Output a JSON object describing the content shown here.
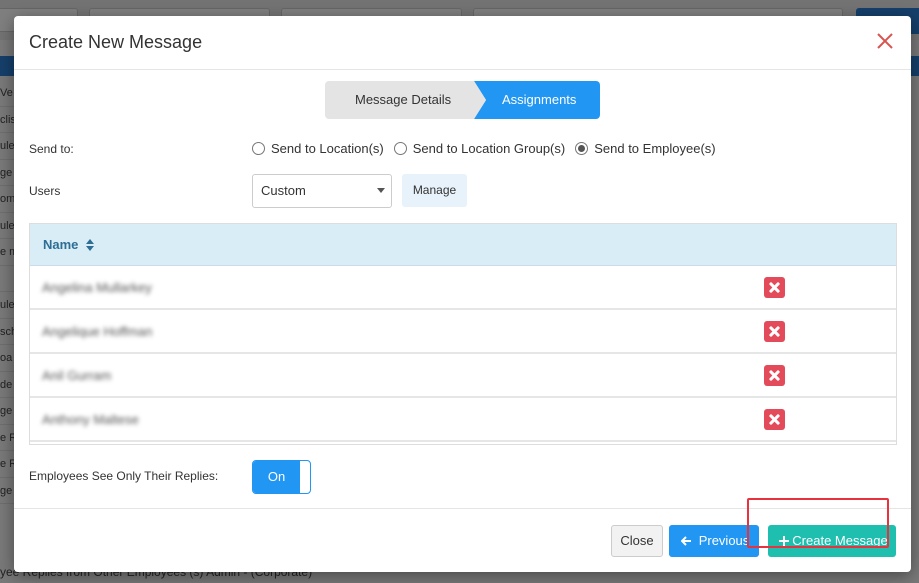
{
  "background": {
    "row_fragments": [
      "Ve",
      "clis",
      "ule",
      "ge",
      "om",
      "ule",
      "e m",
      "",
      "ule",
      "sch",
      "oa",
      "de",
      "ge",
      "e R",
      "e R",
      "ge"
    ],
    "bottom_text": "yee Replies from Other Employees (s)          Admin - (Corporate)"
  },
  "modal": {
    "title": "Create New Message",
    "close_icon": "close-x-icon",
    "steps": [
      {
        "label": "Message Details",
        "active": false
      },
      {
        "label": "Assignments",
        "active": true
      }
    ],
    "send_to": {
      "label": "Send to:",
      "options": [
        {
          "label": "Send to Location(s)",
          "checked": false
        },
        {
          "label": "Send to Location Group(s)",
          "checked": false
        },
        {
          "label": "Send to Employee(s)",
          "checked": true
        }
      ]
    },
    "users": {
      "label": "Users",
      "selected": "Custom",
      "manage_label": "Manage"
    },
    "table": {
      "header": "Name",
      "rows": [
        {
          "name": "Angelina Mullarkey"
        },
        {
          "name": "Angelique Hoffman"
        },
        {
          "name": "Anil Gurram"
        },
        {
          "name": "Anthony Maltese"
        }
      ]
    },
    "replies_toggle": {
      "label": "Employees See Only Their Replies:",
      "value": "On"
    },
    "footer": {
      "close_label": "Close",
      "previous_label": "Previous",
      "create_label": "Create Message"
    }
  },
  "colors": {
    "primary": "#2196f3",
    "create": "#1fbfb0",
    "delete": "#e34b5a",
    "highlight": "#e8323e",
    "table_header": "#d9edf7"
  }
}
